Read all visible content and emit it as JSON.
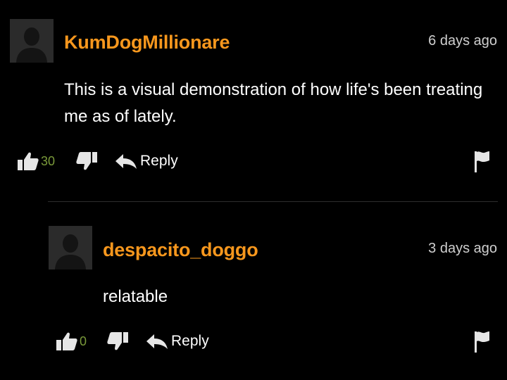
{
  "colors": {
    "username": "#f7971d",
    "like_count": "#7a9a3a",
    "text": "#ffffff",
    "timestamp": "#cfcfcf",
    "icon": "#e6e6e6",
    "background": "#000000"
  },
  "comments": [
    {
      "username": "KumDogMillionare",
      "timestamp": "6 days ago",
      "text": "This is a visual demonstration of how life's been treating me as of lately.",
      "likes": "30",
      "reply_label": "Reply",
      "avatar_icon": "default-user-avatar",
      "actions_icons": [
        "thumbs-up-icon",
        "thumbs-down-icon",
        "reply-arrow-icon",
        "flag-icon"
      ]
    },
    {
      "username": "despacito_doggo",
      "timestamp": "3 days ago",
      "text": "relatable",
      "likes": "0",
      "reply_label": "Reply",
      "avatar_icon": "default-user-avatar",
      "actions_icons": [
        "thumbs-up-icon",
        "thumbs-down-icon",
        "reply-arrow-icon",
        "flag-icon"
      ]
    }
  ]
}
